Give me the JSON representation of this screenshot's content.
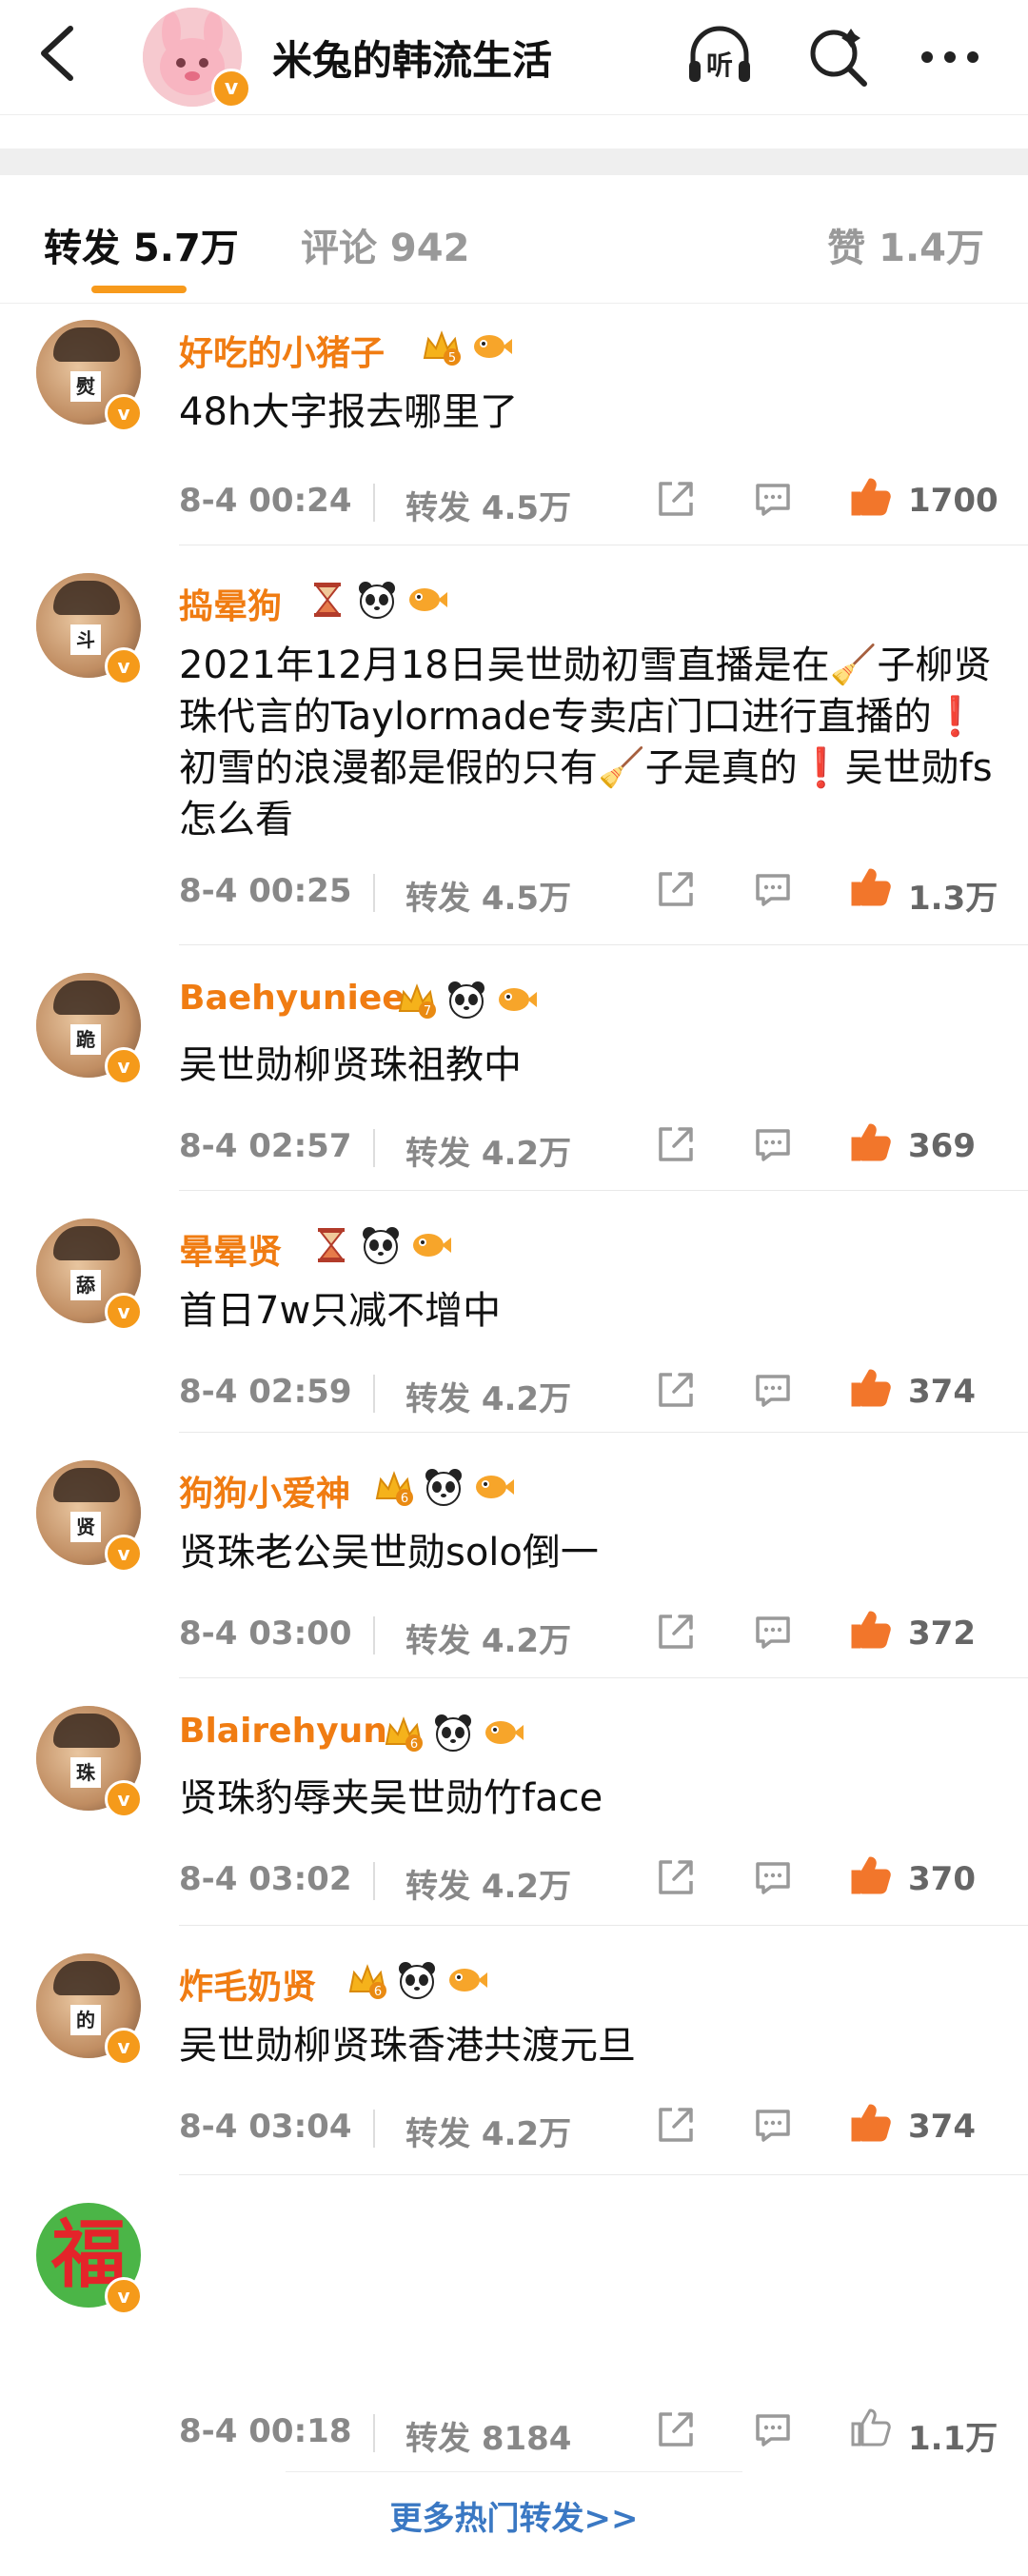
{
  "header": {
    "title": "米兔的韩流生活",
    "avatar_badge": "v",
    "listen_label": "听"
  },
  "tabs": {
    "repost": "转发 5.7万",
    "comment": "评论 942",
    "like": "赞 1.4万"
  },
  "comments": [
    {
      "username": "好吃的小猪子",
      "avatar_tag": "熨",
      "content": "48h大字报去哪里了",
      "time": "8-4 00:24",
      "reposts": "转发 4.5万",
      "likes": "1700",
      "badges": [
        "crown-5-icon",
        "fish-icon"
      ]
    },
    {
      "username": "捣晕狗",
      "avatar_tag": "斗",
      "content": "2021年12月18日吴世勋初雪直播是在🧹子柳贤珠代言的Taylormade专卖店门口进行直播的❗初雪的浪漫都是假的只有🧹子是真的❗吴世勋fs怎么看",
      "time": "8-4 00:25",
      "reposts": "转发 4.5万",
      "likes": "1.3万",
      "badges": [
        "hourglass-icon",
        "panda-icon",
        "fish-icon"
      ]
    },
    {
      "username": "Baehyuniee",
      "avatar_tag": "跪",
      "content": "吴世勋柳贤珠祖教中",
      "time": "8-4 02:57",
      "reposts": "转发 4.2万",
      "likes": "369",
      "badges": [
        "crown-7-icon",
        "panda-icon",
        "fish-icon"
      ]
    },
    {
      "username": "晕晕贤",
      "avatar_tag": "舔",
      "content": "首日7w只减不增中",
      "time": "8-4 02:59",
      "reposts": "转发 4.2万",
      "likes": "374",
      "badges": [
        "hourglass-icon",
        "panda-icon",
        "fish-icon"
      ]
    },
    {
      "username": "狗狗小爱神",
      "avatar_tag": "贤",
      "content": "贤珠老公吴世勋solo倒一",
      "time": "8-4 03:00",
      "reposts": "转发 4.2万",
      "likes": "372",
      "badges": [
        "crown-6-icon",
        "panda-icon",
        "fish-icon"
      ]
    },
    {
      "username": "Blairehyun",
      "avatar_tag": "珠",
      "content": "贤珠豹辱夹吴世勋竹face",
      "time": "8-4 03:02",
      "reposts": "转发 4.2万",
      "likes": "370",
      "badges": [
        "crown-6-icon",
        "panda-icon",
        "fish-icon"
      ]
    },
    {
      "username": "炸毛奶贤",
      "avatar_tag": "的",
      "content": "吴世勋柳贤珠香港共渡元旦",
      "time": "8-4 03:04",
      "reposts": "转发 4.2万",
      "likes": "374",
      "badges": [
        "crown-6-icon",
        "panda-icon",
        "fish-icon"
      ]
    },
    {
      "username": "",
      "avatar_tag": "福",
      "content": "",
      "time": "8-4 00:18",
      "reposts": "转发 8184",
      "likes": "1.1万",
      "badges": []
    }
  ],
  "footer": {
    "more_link": "更多热门转发>>"
  },
  "colors": {
    "accent": "#f07c12",
    "link": "#3a78c3",
    "like_orange": "#f2762b"
  }
}
